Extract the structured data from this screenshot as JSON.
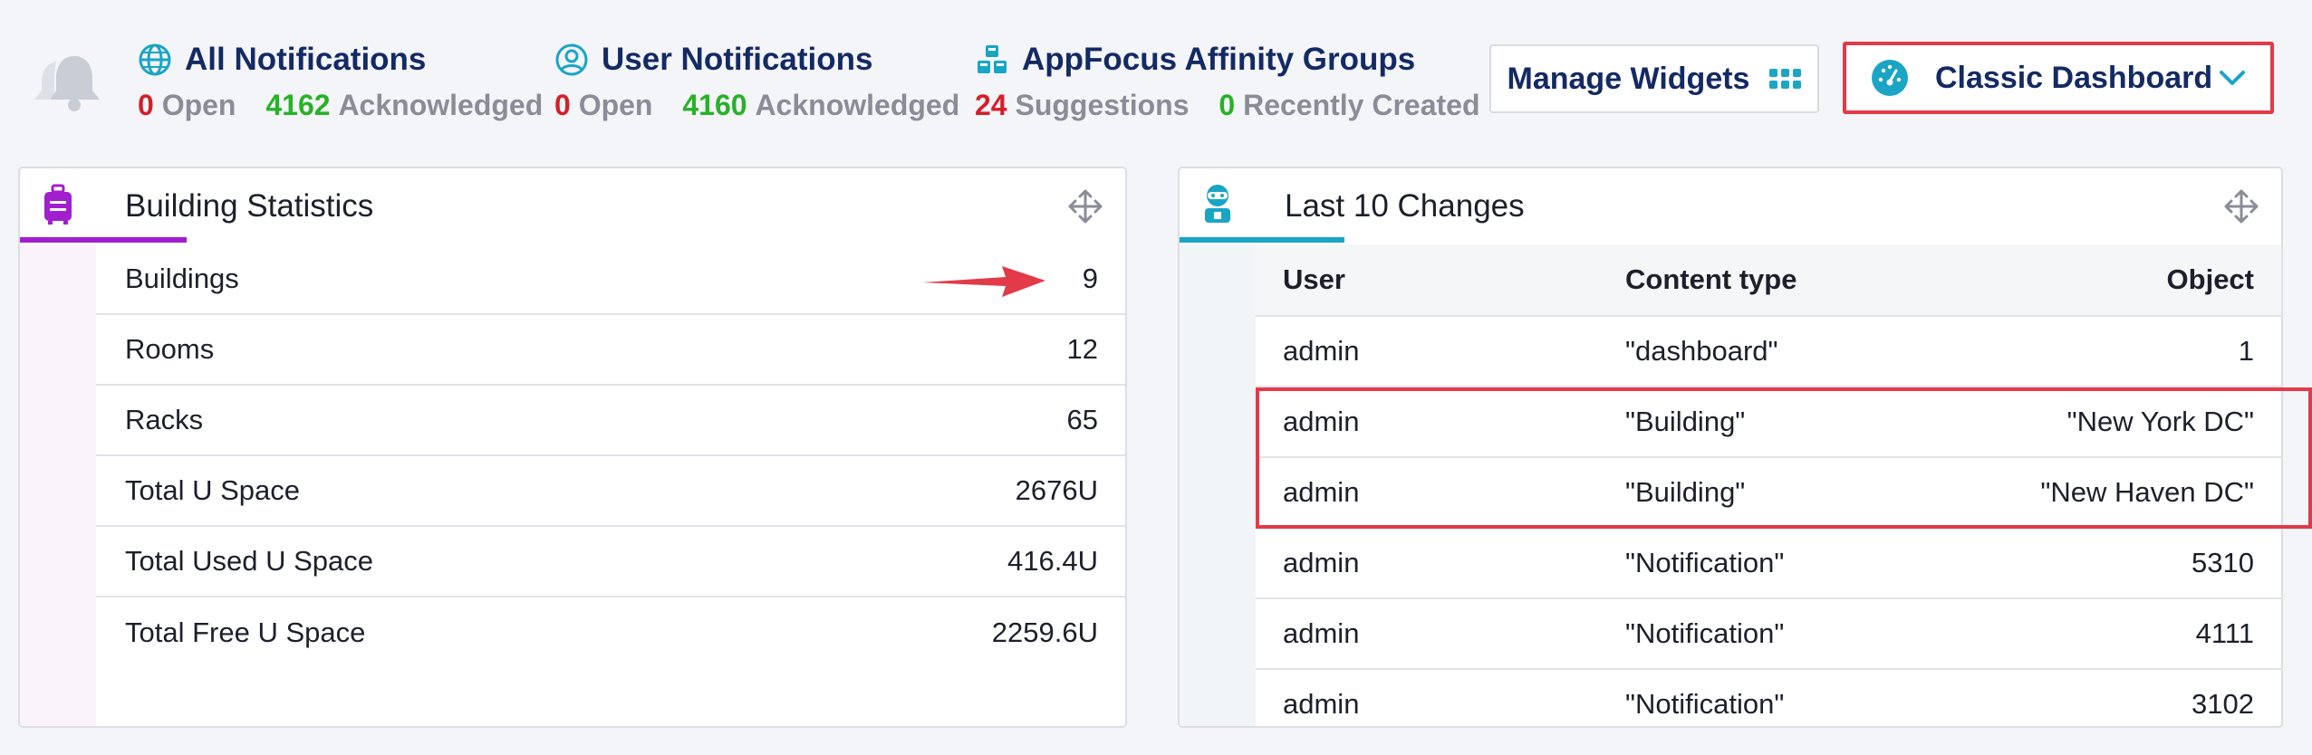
{
  "header": {
    "all_notifications": {
      "title": "All Notifications",
      "open_count": "0",
      "open_label": "Open",
      "ack_count": "4162",
      "ack_label": "Acknowledged"
    },
    "user_notifications": {
      "title": "User Notifications",
      "open_count": "0",
      "open_label": "Open",
      "ack_count": "4160",
      "ack_label": "Acknowledged"
    },
    "affinity_groups": {
      "title": "AppFocus Affinity Groups",
      "suggestions_count": "24",
      "suggestions_label": "Suggestions",
      "created_count": "0",
      "created_label": "Recently Created"
    },
    "manage_widgets_label": "Manage Widgets",
    "dashboard_select": "Classic Dashboard"
  },
  "building_statistics": {
    "title": "Building Statistics",
    "rows": [
      {
        "label": "Buildings",
        "value": "9"
      },
      {
        "label": "Rooms",
        "value": "12"
      },
      {
        "label": "Racks",
        "value": "65"
      },
      {
        "label": "Total U Space",
        "value": "2676U"
      },
      {
        "label": "Total Used U Space",
        "value": "416.4U"
      },
      {
        "label": "Total Free U Space",
        "value": "2259.6U"
      }
    ]
  },
  "last_changes": {
    "title": "Last 10 Changes",
    "columns": [
      "User",
      "Content type",
      "Object"
    ],
    "rows": [
      {
        "user": "admin",
        "content_type": "\"dashboard\"",
        "object": "1"
      },
      {
        "user": "admin",
        "content_type": "\"Building\"",
        "object": "\"New York DC\""
      },
      {
        "user": "admin",
        "content_type": "\"Building\"",
        "object": "\"New Haven DC\""
      },
      {
        "user": "admin",
        "content_type": "\"Notification\"",
        "object": "5310"
      },
      {
        "user": "admin",
        "content_type": "\"Notification\"",
        "object": "4111"
      },
      {
        "user": "admin",
        "content_type": "\"Notification\"",
        "object": "3102"
      }
    ]
  },
  "colors": {
    "brand_navy": "#142a63",
    "accent_teal": "#1aa5c5",
    "purple": "#a21fcf",
    "alert_red": "#d4202b",
    "ok_green": "#27b227",
    "highlight_red": "#e23a48"
  }
}
